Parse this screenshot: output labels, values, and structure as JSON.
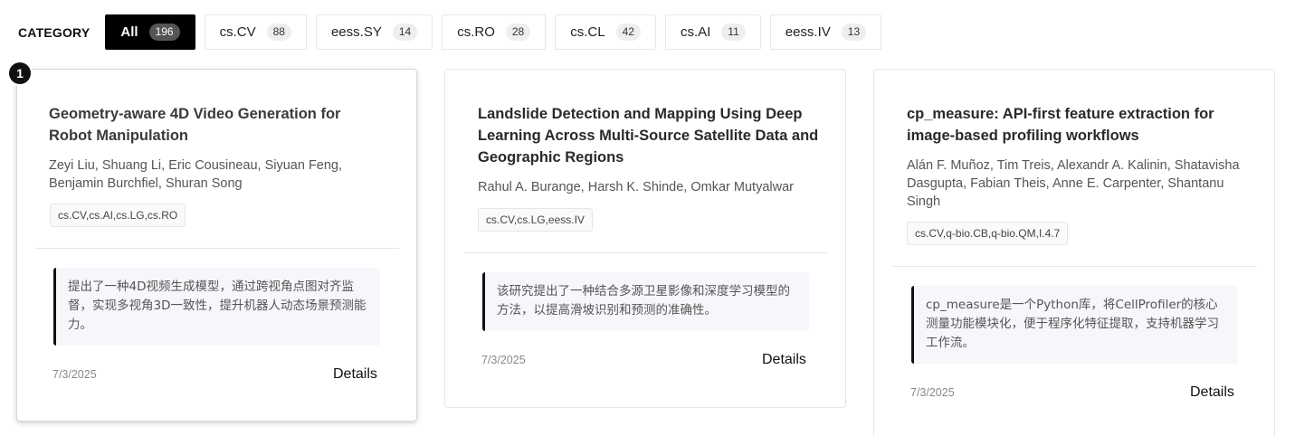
{
  "filters": {
    "label": "CATEGORY",
    "chips": [
      {
        "name": "All",
        "count": "196",
        "active": true
      },
      {
        "name": "cs.CV",
        "count": "88"
      },
      {
        "name": "eess.SY",
        "count": "14"
      },
      {
        "name": "cs.RO",
        "count": "28"
      },
      {
        "name": "cs.CL",
        "count": "42"
      },
      {
        "name": "cs.AI",
        "count": "11"
      },
      {
        "name": "eess.IV",
        "count": "13"
      }
    ]
  },
  "badge": "1",
  "cards": [
    {
      "title": "Geometry-aware 4D Video Generation for Robot Manipulation",
      "authors": "Zeyi Liu, Shuang Li, Eric Cousineau, Siyuan Feng, Benjamin Burchfiel, Shuran Song",
      "tags": "cs.CV,cs.AI,cs.LG,cs.RO",
      "summary": "提出了一种4D视频生成模型，通过跨视角点图对齐监督，实现多视角3D一致性，提升机器人动态场景预测能力。",
      "date": "7/3/2025",
      "details": "Details"
    },
    {
      "title": "Landslide Detection and Mapping Using Deep Learning Across Multi-Source Satellite Data and Geographic Regions",
      "authors": "Rahul A. Burange, Harsh K. Shinde, Omkar Mutyalwar",
      "tags": "cs.CV,cs.LG,eess.IV",
      "summary": "该研究提出了一种结合多源卫星影像和深度学习模型的方法，以提高滑坡识别和预测的准确性。",
      "date": "7/3/2025",
      "details": "Details"
    },
    {
      "title": "cp_measure: API-first feature extraction for image-based profiling workflows",
      "authors": "Alán F. Muñoz, Tim Treis, Alexandr A. Kalinin, Shatavisha Dasgupta, Fabian Theis, Anne E. Carpenter, Shantanu Singh",
      "tags": "cs.CV,q-bio.CB,q-bio.QM,I.4.7",
      "summary": "cp_measure是一个Python库，将CellProfiler的核心测量功能模块化，便于程序化特征提取，支持机器学习工作流。",
      "date": "7/3/2025",
      "details": "Details"
    }
  ]
}
